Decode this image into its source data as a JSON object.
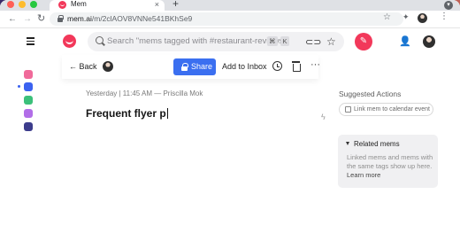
{
  "browser": {
    "tab_title": "Mem",
    "tab_close": "×",
    "new_tab": "+",
    "url_host": "mem.ai",
    "url_path": "/m/2clAOV8VNNe541BKhSe9",
    "icons": [
      "back-arrow-icon",
      "forward-arrow-icon",
      "reload-icon",
      "lock-icon",
      "star-icon",
      "extensions-icon",
      "menu-icon"
    ]
  },
  "app_header": {
    "search_placeholder": "Search \"mems tagged with #restaurant-reviews\"",
    "shortcut_cmd": "⌘",
    "shortcut_key": "K",
    "accent_color": "#f2385a"
  },
  "left_rail": {
    "items": [
      {
        "name": "rail-item-1",
        "color": "#f06a9a"
      },
      {
        "name": "rail-item-2",
        "color": "#3b62f0"
      },
      {
        "name": "rail-item-3",
        "color": "#3bc07a"
      },
      {
        "name": "rail-item-4",
        "color": "#b26ee8"
      },
      {
        "name": "rail-item-5",
        "color": "#3c3c8c"
      }
    ]
  },
  "note_toolbar": {
    "back_label": "← Back",
    "share_label": "Share",
    "add_to_inbox_label": "Add to Inbox",
    "more_label": "···",
    "share_color": "#3b6ff0"
  },
  "note": {
    "meta": "Yesterday | 11:45 AM — Priscilla Mok",
    "title": "Frequent flyer p"
  },
  "right_panel": {
    "suggested_heading": "Suggested Actions",
    "calendar_action": "Link mem to calendar event",
    "related_heading": "Related mems",
    "related_description": "Linked mems and mems with the same tags show up here.",
    "learn_more": "Learn more"
  }
}
